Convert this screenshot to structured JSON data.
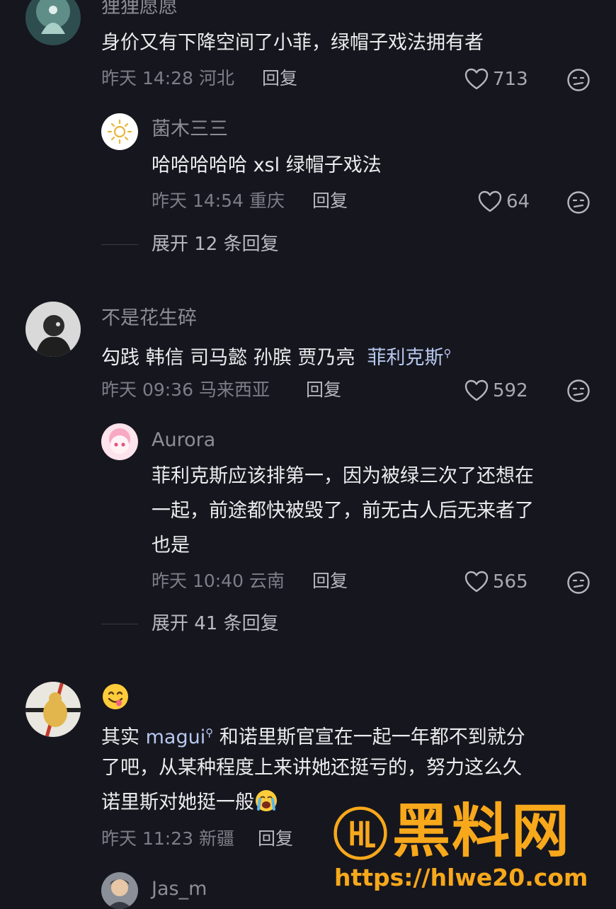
{
  "comments": [
    {
      "user": "狸狸愿愿",
      "text": "身价又有下降空间了小菲，绿帽子戏法拥有者",
      "time": "昨天 14:28 河北",
      "reply_label": "回复",
      "likes": "713",
      "sub": {
        "user": "菌木三三",
        "text": "哈哈哈哈哈 xsl 绿帽子戏法",
        "time": "昨天 14:54 重庆",
        "reply_label": "回复",
        "likes": "64"
      },
      "expand": "展开 12 条回复"
    },
    {
      "user": "不是花生碎",
      "text_prefix": "勾践 韩信 司马懿 孙膑 贾乃亮",
      "mention": "菲利克斯",
      "time": "昨天 09:36 马来西亚",
      "reply_label": "回复",
      "likes": "592",
      "sub": {
        "user": "Aurora",
        "lines": [
          "菲利克斯应该排第一，因为被绿三次了还想在",
          "一起，前途都快被毁了，前无古人后无来者了",
          "也是"
        ],
        "time": "昨天 10:40 云南",
        "reply_label": "回复",
        "likes": "565"
      },
      "expand": "展开 41 条回复"
    },
    {
      "emoji": "yum-face-emoji",
      "line1_prefix": "其实",
      "mention": "magui",
      "line1_suffix": "和诺里斯官宣在一起一年都不到就分",
      "line2": "了吧，从某种程度上来讲她还挺亏的，努力这么久",
      "line3": "诺里斯对她挺一般",
      "line3_emoji": "crying-face-emoji",
      "time": "昨天 11:23 新疆",
      "reply_label": "回复",
      "sub": {
        "user": "Jas_m"
      }
    }
  ],
  "watermark": {
    "logo_text": "HL",
    "title": "黑料网",
    "url": "https://hlwe20.com"
  },
  "colors": {
    "background": "#16161e",
    "watermark": "#f7a81b",
    "mention": "#b7c8ef"
  }
}
